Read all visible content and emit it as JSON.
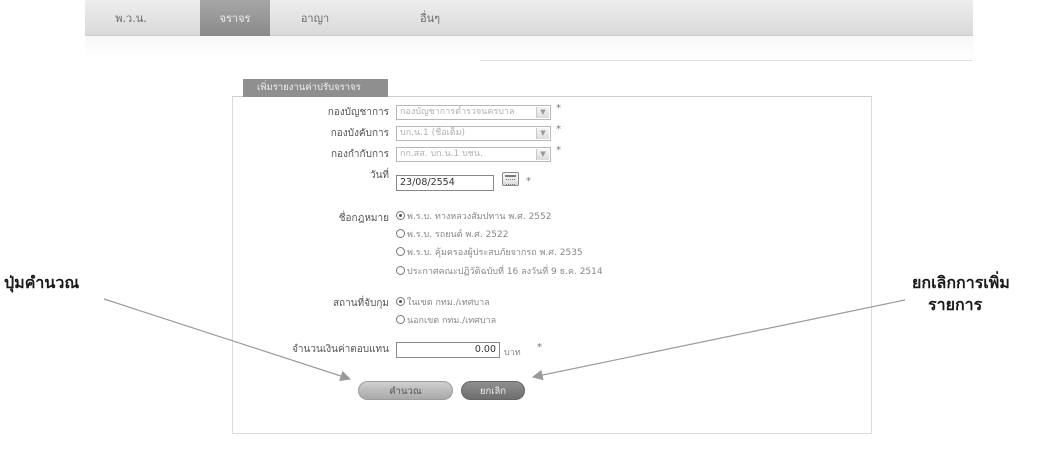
{
  "tabs": [
    {
      "label": "พ.ว.น."
    },
    {
      "label": "จราจร"
    },
    {
      "label": "อาญา"
    },
    {
      "label": "อื่นๆ"
    }
  ],
  "form": {
    "title": "เพิ่มรายงานค่าปรับจราจร",
    "fields": {
      "command": {
        "label": "กองบัญชาการ",
        "value": "กองบัญชาการตำรวจนครบาล"
      },
      "division": {
        "label": "กองบังคับการ",
        "value": "บก.น.1 (ชื่อเต็ม)"
      },
      "station": {
        "label": "กองกำกับการ",
        "value": "กก.สส. บก.น.1 บชน."
      },
      "date": {
        "label": "วันที่",
        "value": "23/08/2554"
      },
      "amount": {
        "label": "จำนวนเงินค่าตอบแทน",
        "value": "0.00",
        "unit": "บาท"
      }
    },
    "required_mark": "*",
    "law": {
      "label": "ชื่อกฎหมาย",
      "options": [
        "พ.ร.บ. ทางหลวงสัมปทาน พ.ศ. 2552",
        "พ.ร.บ. รถยนต์ พ.ศ. 2522",
        "พ.ร.บ. คุ้มครองผู้ประสบภัยจากรถ พ.ศ. 2535",
        "ประกาศคณะปฏิวัติฉบับที่ 16 ลงวันที่ 9 ธ.ค. 2514"
      ],
      "selected": 0
    },
    "location": {
      "label": "สถานที่จับกุม",
      "options": [
        "ในเขต กทม./เทศบาล",
        "นอกเขต กทม./เทศบาล"
      ],
      "selected": 0
    },
    "buttons": {
      "calculate": "คำนวณ",
      "cancel": "ยกเลิก"
    }
  },
  "annotations": {
    "left": "ปุ่มคำนวณ",
    "right_line1": "ยกเลิกการเพิ่ม",
    "right_line2": "รายการ"
  }
}
